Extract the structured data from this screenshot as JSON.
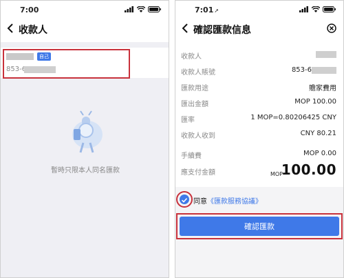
{
  "left_screen": {
    "status_time": "7:00",
    "title": "收款人",
    "recipient": {
      "tag": "自己",
      "account_prefix": "853-6"
    },
    "empty_text": "暫時只限本人同名匯款"
  },
  "right_screen": {
    "status_time": "7:01",
    "title": "確認匯款信息",
    "rows": [
      {
        "label": "收款人",
        "value": ""
      },
      {
        "label": "收款人賬號",
        "value": "853-6"
      },
      {
        "label": "匯款用途",
        "value": "贍家費用"
      },
      {
        "label": "匯出金額",
        "value": "MOP 100.00"
      },
      {
        "label": "匯率",
        "value": "1 MOP=0.80206425 CNY"
      },
      {
        "label": "收款人收到",
        "value": "CNY 80.21"
      },
      {
        "label": "手續費",
        "value": "MOP 0.00"
      }
    ],
    "total_label": "應支付金額",
    "total_currency": "MOP",
    "total_amount": "100.00",
    "agree_prefix": "同意",
    "agree_link": "《匯款服務協議》",
    "confirm_label": "確認匯款"
  },
  "colors": {
    "accent": "#3f79e8",
    "highlight_red": "#c8313b"
  },
  "icons": {
    "back": "chevron-left-icon",
    "close": "close-circle-icon",
    "signal": "signal-icon",
    "wifi": "wifi-icon",
    "battery": "battery-icon",
    "check": "check-icon"
  }
}
